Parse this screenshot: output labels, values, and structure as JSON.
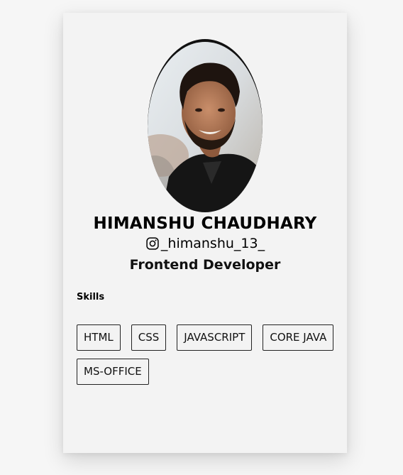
{
  "profile": {
    "name": "HIMANSHU CHAUDHARY",
    "instagram_handle": "_himanshu_13_",
    "role": "Frontend Developer",
    "avatar_icon": "profile-photo"
  },
  "skills": {
    "title": "Skills",
    "items": [
      "HTML",
      "CSS",
      "JAVASCRIPT",
      "CORE JAVA",
      "MS-OFFICE"
    ]
  },
  "colors": {
    "card_background": "#f3f3f3",
    "avatar_ring": "#111111",
    "text": "#000000"
  }
}
